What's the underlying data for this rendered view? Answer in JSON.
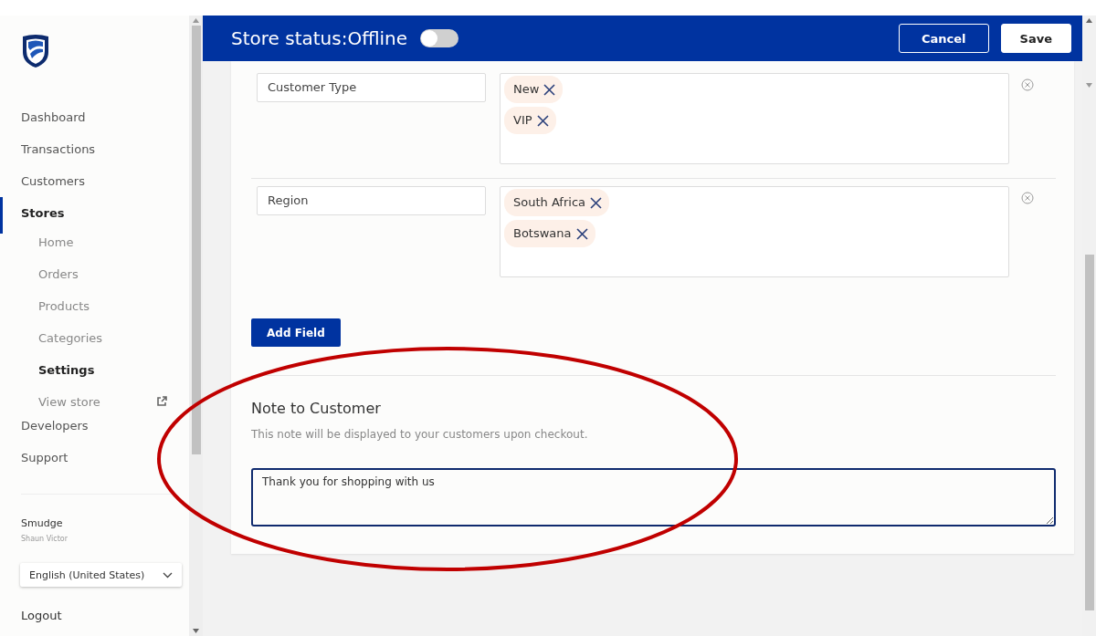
{
  "store_status": {
    "label": "Store status:Offline",
    "on": false
  },
  "header_buttons": [
    {
      "label": "Cancel",
      "kind": "outline"
    },
    {
      "label": "Save",
      "kind": "solid"
    }
  ],
  "sidebar": {
    "items": [
      {
        "label": "Dashboard",
        "selected": false
      },
      {
        "label": "Transactions",
        "selected": false
      },
      {
        "label": "Customers",
        "selected": false
      },
      {
        "label": "Stores",
        "selected": true,
        "children": [
          {
            "label": "Home",
            "selected": false
          },
          {
            "label": "Orders",
            "selected": false
          },
          {
            "label": "Products",
            "selected": false
          },
          {
            "label": "Categories",
            "selected": false
          },
          {
            "label": "Settings",
            "selected": true
          },
          {
            "label": "View store",
            "selected": false,
            "kind": "external"
          }
        ]
      },
      {
        "label": "Developers",
        "selected": false
      },
      {
        "label": "Support",
        "selected": false
      }
    ]
  },
  "user": {
    "name": "Smudge",
    "subtitle": "Shaun Victor"
  },
  "language": {
    "value": "English (United States)"
  },
  "logout": "Logout",
  "fields": [
    {
      "name": "Customer Type",
      "tags": [
        "New",
        "VIP"
      ]
    },
    {
      "name": "Region",
      "tags": [
        "South Africa",
        "Botswana"
      ]
    }
  ],
  "add_field": "Add Field",
  "note": {
    "title": "Note to Customer",
    "description": "This note will be displayed to your customers upon checkout.",
    "value": "Thank you for shopping with us"
  }
}
